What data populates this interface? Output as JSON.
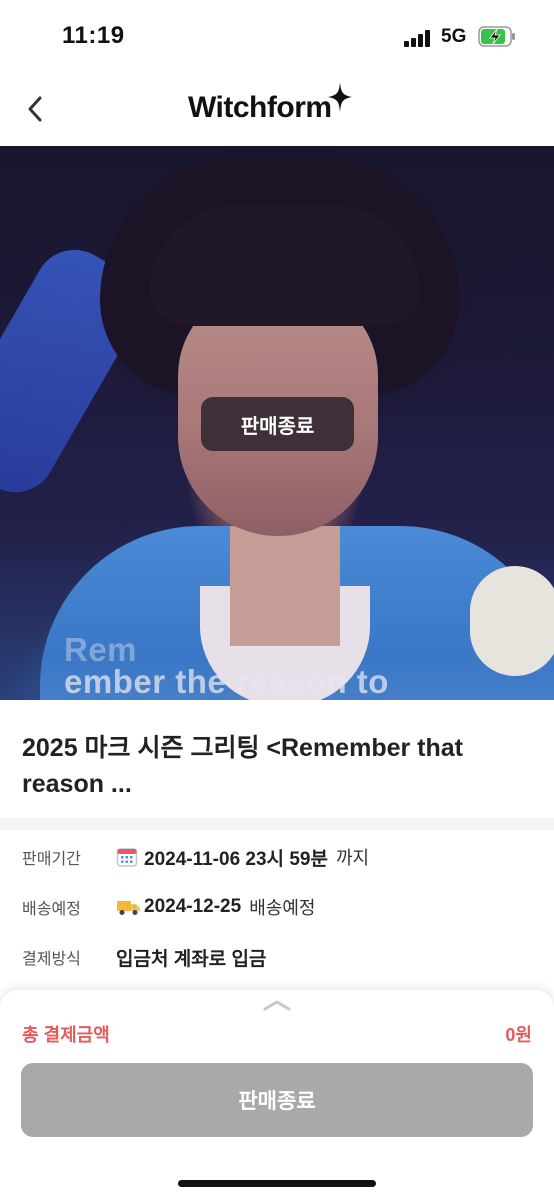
{
  "status_bar": {
    "time": "11:19",
    "network": "5G",
    "icons": [
      "signal-icon",
      "battery-charging-icon"
    ]
  },
  "header": {
    "logo_text": "Witchform",
    "back_icon": "chevron-left-icon",
    "logo_icon": "sparkle-star-icon"
  },
  "hero": {
    "badge": "판매종료",
    "caption_line1": "Rem",
    "caption_line2": "ember the reason to"
  },
  "product": {
    "title": "2025 마크 시즌 그리팅 <Remember that reason ..."
  },
  "info": [
    {
      "label": "판매기간",
      "icon": "calendar-icon",
      "value": "2024-11-06 23시 59분",
      "suffix": "까지"
    },
    {
      "label": "배송예정",
      "icon": "delivery-truck-icon",
      "value": "2024-12-25",
      "suffix": "배송예정"
    },
    {
      "label": "결제방식",
      "icon": "",
      "value": "입금처 계좌로 입금",
      "suffix": ""
    }
  ],
  "bottom_sheet": {
    "handle_icon": "chevron-up-icon",
    "total_label": "총 결제금액",
    "total_value": "0원",
    "button_label": "판매종료"
  },
  "colors": {
    "accent_red": "#e55b5b",
    "disabled_button": "#a9a9a9",
    "badge_bg": "#28202c"
  }
}
